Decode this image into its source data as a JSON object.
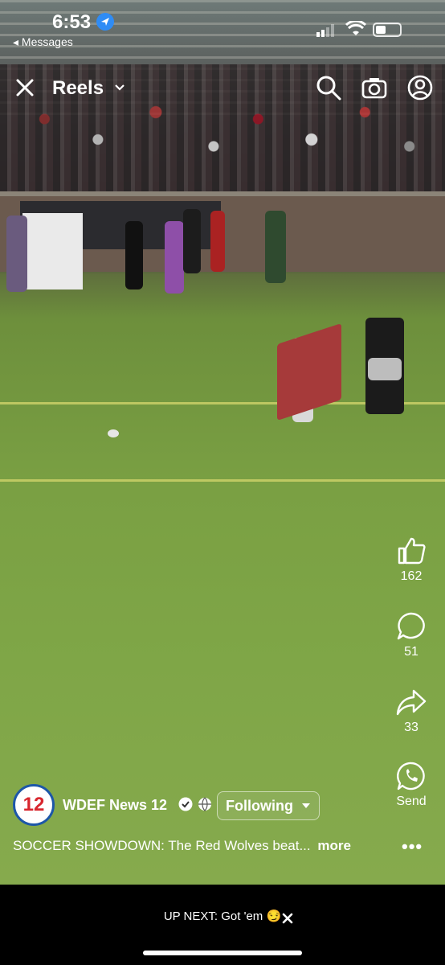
{
  "status_bar": {
    "time": "6:53",
    "back_label": "◂ Messages"
  },
  "top_bar": {
    "title": "Reels",
    "icons": [
      "close-icon",
      "chevron-down-icon",
      "search-icon",
      "camera-icon",
      "profile-icon"
    ]
  },
  "actions": {
    "like_count": "162",
    "comment_count": "51",
    "share_count": "33",
    "send_label": "Send"
  },
  "post": {
    "logo_text": "12",
    "author": "WDEF News 12",
    "follow_label": "Following",
    "caption": "SOCCER SHOWDOWN: The Red Wolves beat...",
    "more_label": "more",
    "dots": "•••"
  },
  "up_next": {
    "label": "UP NEXT:",
    "title": "Got 'em",
    "emoji": "😏"
  },
  "colors": {
    "background": "#000000",
    "location_blue": "#2f8cf5",
    "logo_red": "#d8262e",
    "logo_blue": "#1d57a8"
  }
}
